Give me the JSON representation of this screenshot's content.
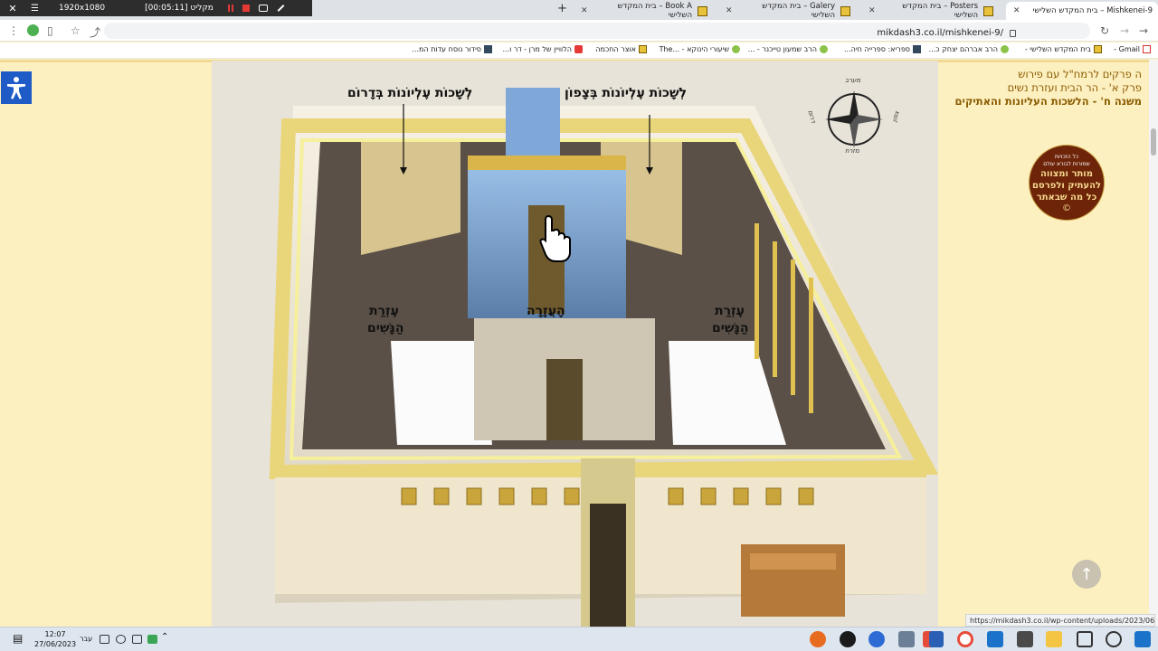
{
  "recorder": {
    "close": "✕",
    "menu": "☰",
    "resolution": "1920x1080",
    "timer": "[00:05:11] מקליט"
  },
  "tabs": [
    {
      "label": "Mishkenei-9 – בית המקדש השלישי",
      "close": "✕"
    },
    {
      "label": "Posters – בית המקדש השלישי",
      "close": "✕"
    },
    {
      "label": "Galery – בית המקדש השלישי",
      "close": "✕"
    },
    {
      "label": "Book A – בית המקדש השלישי",
      "close": "✕"
    }
  ],
  "new_tab": "+",
  "address": {
    "url": "mikdash3.co.il/mishkenei-9/"
  },
  "bookmarks": [
    {
      "label": "Gmail -",
      "icon": "gmail-icon"
    },
    {
      "label": "בית המקדש השלישי -",
      "icon": "temple-icon"
    },
    {
      "label": "הרב אברהם יצחק כ...",
      "icon": "leaf-icon"
    },
    {
      "label": "ספריא: ספרייה חיה...",
      "icon": "sefaria-icon"
    },
    {
      "label": "הרב שמעון טייכנר - ...",
      "icon": "leaf-icon"
    },
    {
      "label": "שיעורי הינוקא - ...The",
      "icon": "leaf-icon"
    },
    {
      "label": "אוצר החכמה",
      "icon": "book-icon"
    },
    {
      "label": "הלוויין של מרן - דר ו...",
      "icon": "youtube-icon"
    },
    {
      "label": "סידור נוסח עדות המ...",
      "icon": "siddur-icon"
    }
  ],
  "image_labels": {
    "north_chambers": "לְשָׁכוֹת עֶלְיוֹנוֹת בְּצָפוֹן",
    "south_chambers": "לְשָׁכוֹת עֶלְיוֹנוֹת בְּדָרוֹם",
    "azara": "הָעֲזָרָה",
    "womens_court_right_1": "עֶזְרַת",
    "womens_court_right_2": "הַנָּשִׁים",
    "womens_court_left_1": "עֶזְרַת",
    "womens_court_left_2": "הַנָּשִׁים",
    "compass_west": "מערב",
    "compass_east": "מזרח",
    "compass_north": "צפון",
    "compass_south": "דרום"
  },
  "right_panel": {
    "line1": "ה פרקים לרמח\"ל עם פירוש",
    "line2": "פרק א' - הר הבית ועזרת נשים",
    "line3": "משנה ח' - הלשכות העליונות והאתיקים",
    "badge_small_1": "כל הזכויות",
    "badge_small_2": "שמורות לבורא עולם",
    "badge_big_1": "מותר ומצווה",
    "badge_big_2": "להעתיק ולפרסם",
    "badge_big_3": "כל מה שבאתר",
    "badge_copy": "©"
  },
  "scroll_top": "↑",
  "status_url": "https://mikdash3.co.il/wp-content/uploads/2023/06/53.jpg",
  "taskbar": {
    "time": "12:07",
    "date": "27/06/2023",
    "language": "עבר"
  },
  "colors": {
    "gold": "#e9d57a",
    "brown_badge": "#6d2409",
    "accent_blue": "#1e5bc6",
    "page_bg": "#fdf0c0"
  }
}
